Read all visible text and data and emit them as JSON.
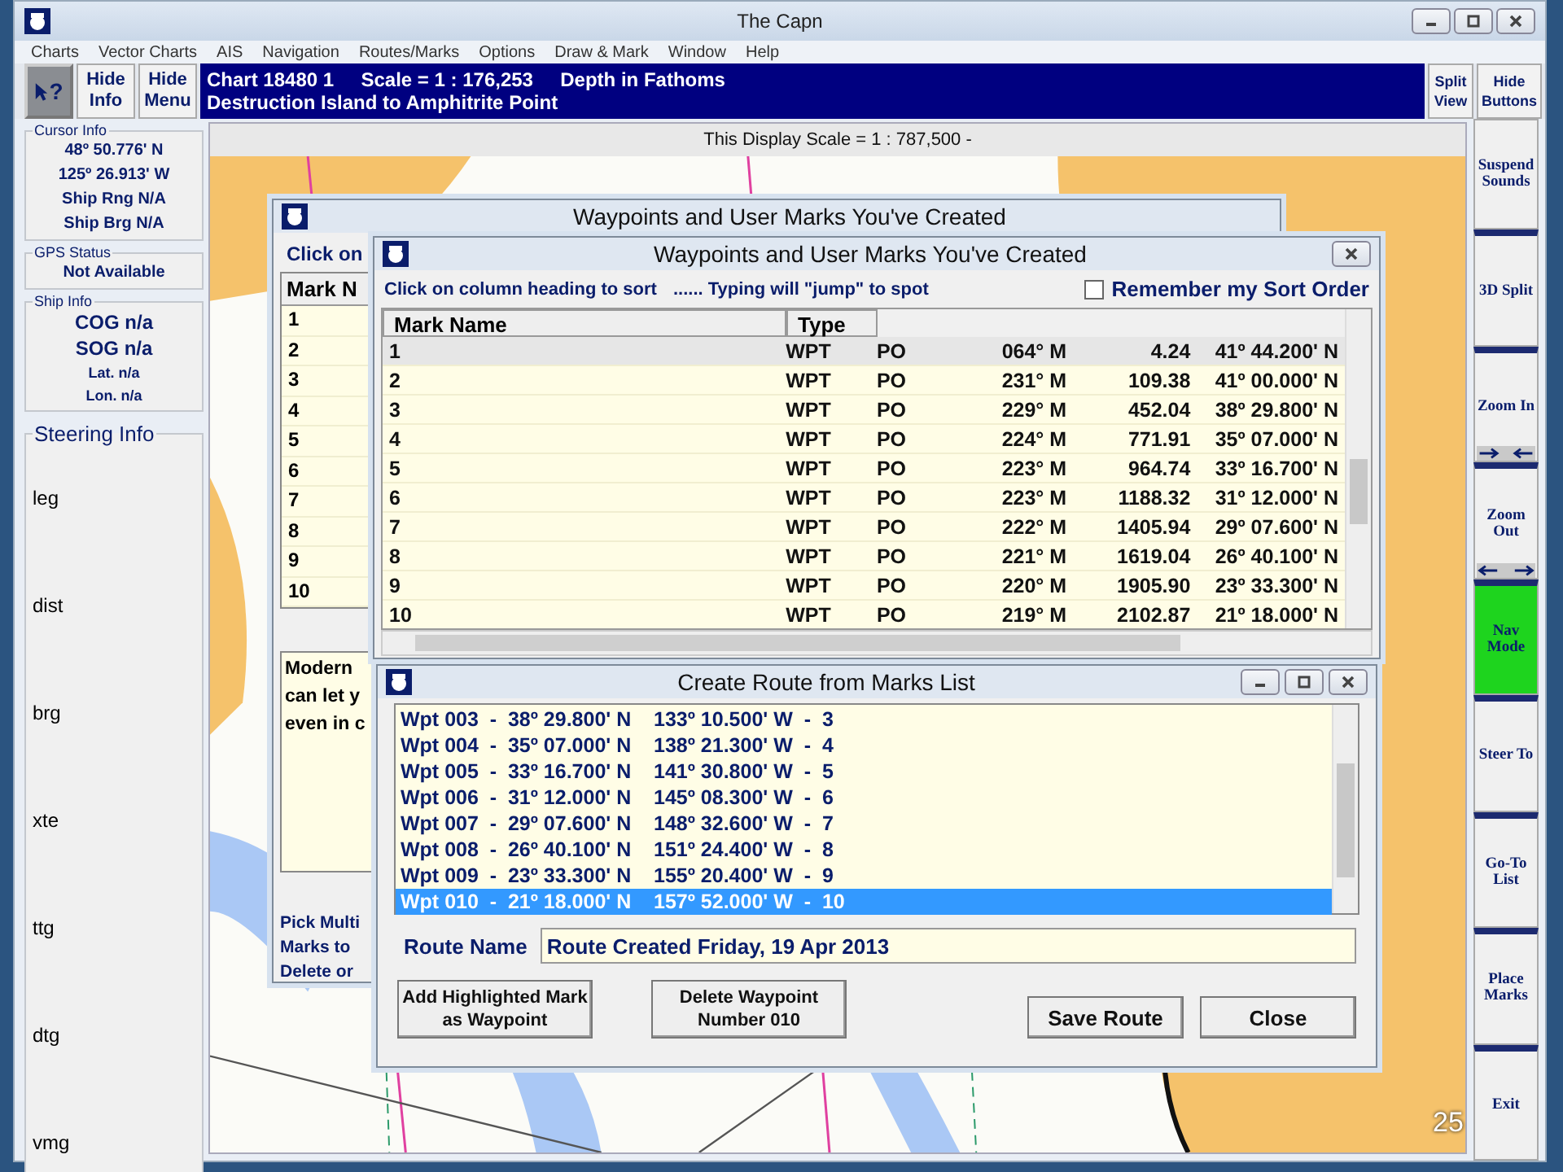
{
  "window": {
    "title": "The Capn"
  },
  "menu": [
    "Charts",
    "Vector Charts",
    "AIS",
    "Navigation",
    "Routes/Marks",
    "Options",
    "Draw & Mark",
    "Window",
    "Help"
  ],
  "toolbar": {
    "help_glyph": "?",
    "buttons": [
      "Hide Info",
      "Hide Menu"
    ],
    "chart_line_1": "Chart 18480 1     Scale = 1 : 176,253     Depth in Fathoms",
    "chart_line_2": "Destruction Island to Amphitrite Point",
    "right_buttons": [
      "Split View",
      "Hide Buttons"
    ]
  },
  "cursor_info": {
    "title": "Cursor Info",
    "lines": [
      "48º 50.776' N",
      "125º 26.913' W",
      "Ship Rng N/A",
      "Ship Brg N/A"
    ]
  },
  "gps_status": {
    "title": "GPS Status",
    "value": "Not Available"
  },
  "ship_info": {
    "title": "Ship Info",
    "lines": [
      {
        "text": "COG n/a",
        "kind": "large"
      },
      {
        "text": "SOG n/a",
        "kind": "large"
      },
      {
        "text": "Lat. n/a",
        "kind": "small"
      },
      {
        "text": "Lon. n/a",
        "kind": "small"
      }
    ]
  },
  "steering_info": {
    "title": "Steering Info",
    "items": [
      "leg",
      "dist",
      "brg",
      "xte",
      "ttg",
      "dtg",
      "vmg"
    ]
  },
  "display_scale": "This Display Scale = 1 : 787,500   -",
  "side_buttons": [
    {
      "label": "Suspend Sounds",
      "kind": "plain",
      "active": false
    },
    {
      "label": "3D Split",
      "kind": "plain",
      "active": false
    },
    {
      "label": "Zoom In",
      "kind": "zoom_in",
      "active": false
    },
    {
      "label": "Zoom Out",
      "kind": "zoom_out",
      "active": false
    },
    {
      "label": "Nav Mode",
      "kind": "plain",
      "active": true
    },
    {
      "label": "Steer To",
      "kind": "plain",
      "active": false
    },
    {
      "label": "Go-To List",
      "kind": "plain",
      "active": false
    },
    {
      "label": "Place Marks",
      "kind": "plain",
      "active": false
    },
    {
      "label": "Exit",
      "kind": "plain",
      "active": false
    }
  ],
  "back_window": {
    "title": "Waypoints and User Marks You've Created",
    "hint": "Click on",
    "column": "Mark N",
    "rows": [
      "1",
      "2",
      "3",
      "4",
      "5",
      "6",
      "7",
      "8",
      "9",
      "10"
    ],
    "note_lines": [
      "Modern",
      "can let y",
      "even in c"
    ],
    "pick_lines": [
      "Pick Multi",
      "Marks to",
      "Delete or"
    ]
  },
  "marks_window": {
    "title": "Waypoints and User Marks You've Created",
    "sort_hint": "Click on column heading to sort",
    "jump_hint": "...... Typing will \"jump\" to spot",
    "remember": {
      "label": "Remember my Sort Order",
      "checked": false
    },
    "columns": [
      "Mark Name",
      "Type"
    ],
    "rows": [
      {
        "cells": [
          "1",
          "WPT",
          "PO",
          "064° M",
          "4.24",
          "41º 44.200' N"
        ],
        "selected": true
      },
      {
        "cells": [
          "2",
          "WPT",
          "PO",
          "231° M",
          "109.38",
          "41º 00.000' N"
        ],
        "selected": false
      },
      {
        "cells": [
          "3",
          "WPT",
          "PO",
          "229° M",
          "452.04",
          "38º 29.800' N"
        ],
        "selected": false
      },
      {
        "cells": [
          "4",
          "WPT",
          "PO",
          "224° M",
          "771.91",
          "35º 07.000' N"
        ],
        "selected": false
      },
      {
        "cells": [
          "5",
          "WPT",
          "PO",
          "223° M",
          "964.74",
          "33º 16.700' N"
        ],
        "selected": false
      },
      {
        "cells": [
          "6",
          "WPT",
          "PO",
          "223° M",
          "1188.32",
          "31º 12.000' N"
        ],
        "selected": false
      },
      {
        "cells": [
          "7",
          "WPT",
          "PO",
          "222° M",
          "1405.94",
          "29º 07.600' N"
        ],
        "selected": false
      },
      {
        "cells": [
          "8",
          "WPT",
          "PO",
          "221° M",
          "1619.04",
          "26º 40.100' N"
        ],
        "selected": false
      },
      {
        "cells": [
          "9",
          "WPT",
          "PO",
          "220° M",
          "1905.90",
          "23º 33.300' N"
        ],
        "selected": false
      },
      {
        "cells": [
          "10",
          "WPT",
          "PO",
          "219° M",
          "2102.87",
          "21º 18.000' N"
        ],
        "selected": false
      }
    ]
  },
  "route_window": {
    "title": "Create Route from Marks List",
    "items": [
      {
        "text": "Wpt 003  -  38º 29.800' N    133º 10.500' W  -  3",
        "selected": false
      },
      {
        "text": "Wpt 004  -  35º 07.000' N    138º 21.300' W  -  4",
        "selected": false
      },
      {
        "text": "Wpt 005  -  33º 16.700' N    141º 30.800' W  -  5",
        "selected": false
      },
      {
        "text": "Wpt 006  -  31º 12.000' N    145º 08.300' W  -  6",
        "selected": false
      },
      {
        "text": "Wpt 007  -  29º 07.600' N    148º 32.600' W  -  7",
        "selected": false
      },
      {
        "text": "Wpt 008  -  26º 40.100' N    151º 24.400' W  -  8",
        "selected": false
      },
      {
        "text": "Wpt 009  -  23º 33.300' N    155º 20.400' W  -  9",
        "selected": false
      },
      {
        "text": "Wpt 010  -  21º 18.000' N    157º 52.000' W  -  10",
        "selected": true
      }
    ],
    "route_name_label": "Route Name",
    "route_name": "Route Created Friday, 19 Apr 2013",
    "buttons": [
      "Add Highlighted Mark as Waypoint",
      "Delete Waypoint Number 010",
      "Save Route",
      "Close"
    ]
  },
  "slide_number": "25"
}
